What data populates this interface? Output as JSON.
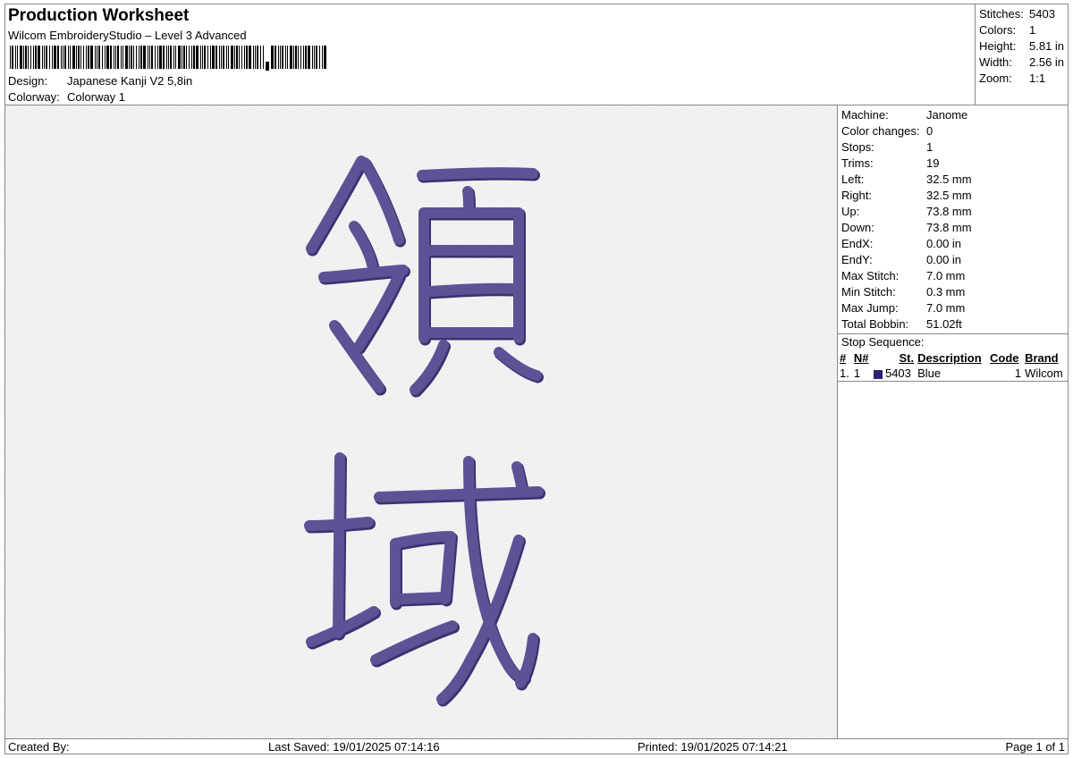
{
  "header": {
    "title": "Production Worksheet",
    "subtitle": "Wilcom EmbroideryStudio – Level 3 Advanced",
    "design_label": "Design:",
    "design_value": "Japanese Kanji V2 5,8in",
    "colorway_label": "Colorway:",
    "colorway_value": "Colorway 1"
  },
  "summary": [
    {
      "label": "Stitches:",
      "value": "5403"
    },
    {
      "label": "Colors:",
      "value": "1"
    },
    {
      "label": "Height:",
      "value": "5.81 in"
    },
    {
      "label": "Width:",
      "value": "2.56 in"
    },
    {
      "label": "Zoom:",
      "value": "1:1"
    }
  ],
  "machine_info": [
    {
      "label": "Machine:",
      "value": "Janome"
    },
    {
      "label": "Color changes:",
      "value": "0"
    },
    {
      "label": "Stops:",
      "value": "1"
    },
    {
      "label": "Trims:",
      "value": "19"
    },
    {
      "label": "Left:",
      "value": "32.5 mm"
    },
    {
      "label": "Right:",
      "value": "32.5 mm"
    },
    {
      "label": "Up:",
      "value": "73.8 mm"
    },
    {
      "label": "Down:",
      "value": "73.8 mm"
    },
    {
      "label": "EndX:",
      "value": "0.00 in"
    },
    {
      "label": "EndY:",
      "value": "0.00 in"
    },
    {
      "label": "Max Stitch:",
      "value": "7.0 mm"
    },
    {
      "label": "Min Stitch:",
      "value": "0.3 mm"
    },
    {
      "label": "Max Jump:",
      "value": "7.0 mm"
    },
    {
      "label": "Total Bobbin:",
      "value": "51.02ft"
    }
  ],
  "stop_sequence": {
    "title": "Stop Sequence:",
    "headers": [
      "#",
      "N#",
      "St.",
      "Description",
      "Code",
      "Brand"
    ],
    "rows": [
      {
        "num": "1.",
        "n": "1",
        "stitches": "5403",
        "description": "Blue",
        "code": "1",
        "brand": "Wilcom",
        "color": "#2b2270"
      }
    ]
  },
  "thread_color": "#5b5396",
  "thread_shadow": "#3a3270",
  "footer": {
    "created_by": "Created By:",
    "last_saved": "Last Saved: 19/01/2025 07:14:16",
    "printed": "Printed: 19/01/2025 07:14:21",
    "page": "Page 1 of 1"
  }
}
